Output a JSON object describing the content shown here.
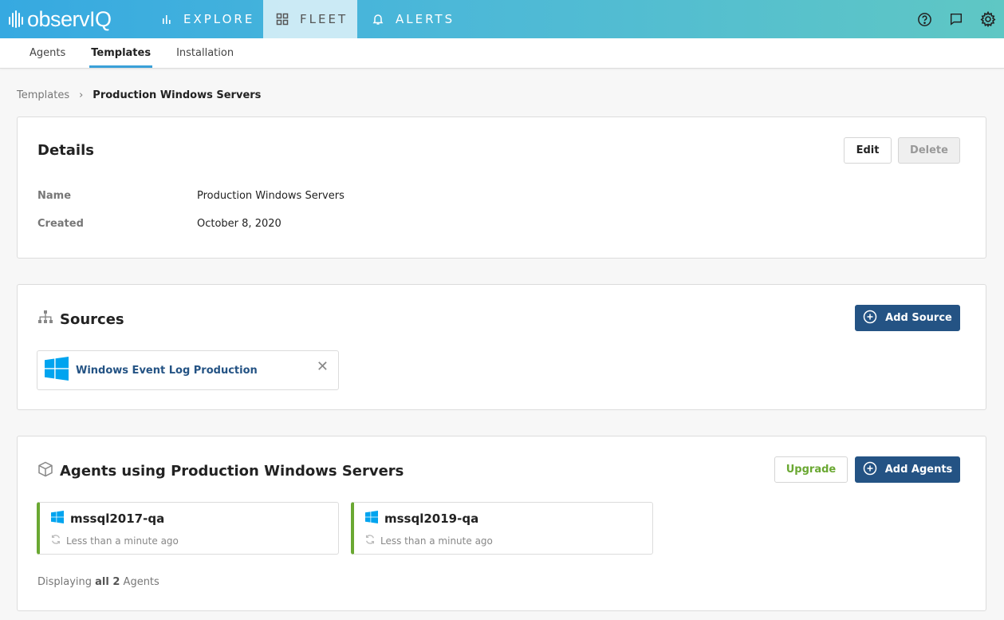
{
  "brand": {
    "name": "observIQ"
  },
  "nav": {
    "items": [
      {
        "label": "EXPLORE",
        "icon": "bar-chart-icon"
      },
      {
        "label": "FLEET",
        "icon": "grid-icon",
        "active": true
      },
      {
        "label": "ALERTS",
        "icon": "bell-icon"
      }
    ],
    "right_icons": [
      "help-icon",
      "chat-icon",
      "settings-icon"
    ]
  },
  "subnav": {
    "tabs": [
      {
        "label": "Agents"
      },
      {
        "label": "Templates",
        "active": true
      },
      {
        "label": "Installation"
      }
    ]
  },
  "breadcrumb": {
    "parent": "Templates",
    "separator": "›",
    "current": "Production Windows Servers"
  },
  "details": {
    "title": "Details",
    "edit_label": "Edit",
    "delete_label": "Delete",
    "rows": [
      {
        "key": "Name",
        "value": "Production Windows Servers"
      },
      {
        "key": "Created",
        "value": "October 8, 2020"
      }
    ]
  },
  "sources": {
    "title": "Sources",
    "add_label": "Add Source",
    "items": [
      {
        "label": "Windows Event Log Production",
        "icon": "windows-icon"
      }
    ],
    "remove_glyph": "✕"
  },
  "agents": {
    "title": "Agents using Production Windows Servers",
    "upgrade_label": "Upgrade",
    "add_label": "Add Agents",
    "items": [
      {
        "name": "mssql2017-qa",
        "status": "Less than a minute ago"
      },
      {
        "name": "mssql2019-qa",
        "status": "Less than a minute ago"
      }
    ],
    "footer_prefix": "Displaying ",
    "footer_bold": "all 2",
    "footer_suffix": " Agents"
  },
  "colors": {
    "accent": "#245384",
    "online": "#6aa832",
    "tab_underline": "#3aa0d8",
    "windows_blue": "#00a4ef"
  }
}
